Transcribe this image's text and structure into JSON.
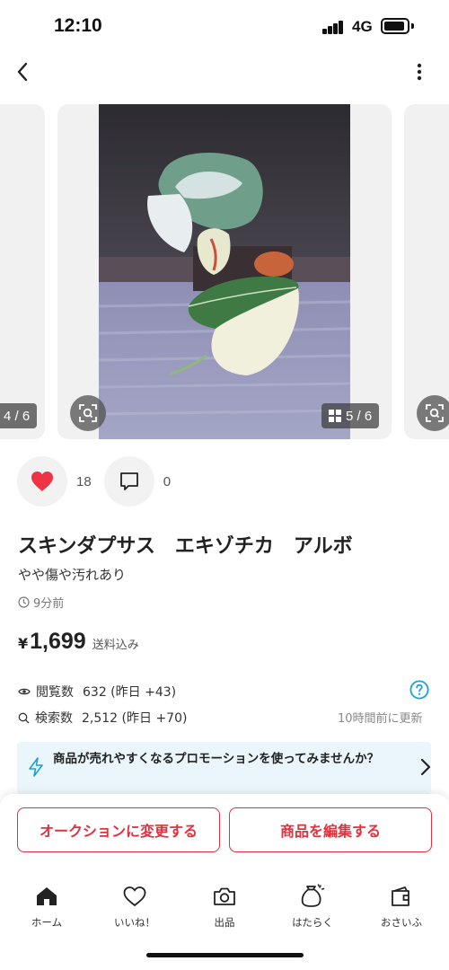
{
  "status_bar": {
    "time": "12:10",
    "network": "4G"
  },
  "carousel": {
    "prev_counter": "4 / 6",
    "counter": "5 / 6"
  },
  "actions": {
    "like_count": "18",
    "comment_count": "0"
  },
  "product": {
    "title": "スキンダプサス　エキゾチカ　アルボ",
    "condition": "やや傷や汚れあり",
    "posted": "9分前",
    "price_symbol": "¥",
    "price": "1,699",
    "shipping_note": "送料込み"
  },
  "stats": {
    "views_label": "閲覧数",
    "views_value": "632 (昨日 +43)",
    "search_label": "検索数",
    "search_value": "2,512 (昨日 +70)",
    "updated": "10時間前に更新"
  },
  "promo": {
    "text": "商品が売れやすくなるプロモーションを使ってみませんか？"
  },
  "cta": {
    "auction": "オークションに変更する",
    "edit": "商品を編集する"
  },
  "tabbar": {
    "items": [
      {
        "label": "ホーム",
        "icon": "home-icon"
      },
      {
        "label": "いいね！",
        "icon": "heart-outline-icon"
      },
      {
        "label": "出品",
        "icon": "camera-icon"
      },
      {
        "label": "はたらく",
        "icon": "money-bag-icon"
      },
      {
        "label": "おさいふ",
        "icon": "wallet-icon"
      }
    ]
  },
  "colors": {
    "accent": "#e0313d",
    "like": "#ee3344",
    "info": "#1aa0d8",
    "promo_bg": "#eaf6fb"
  }
}
